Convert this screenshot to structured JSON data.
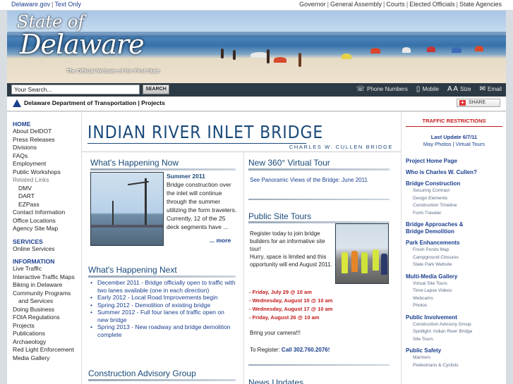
{
  "topbar": {
    "left": [
      "Delaware.gov",
      "Text Only"
    ],
    "right": [
      "Governor",
      "General Assembly",
      "Courts",
      "Elected Officials",
      "State Agencies"
    ]
  },
  "banner": {
    "logo_line1": "State of",
    "logo_line2": "Delaware",
    "tagline": "The Official Website of the First State"
  },
  "search": {
    "placeholder": "Your Search...",
    "button": "SEARCH"
  },
  "tools": {
    "phone": "Phone Numbers",
    "mobile": "Mobile",
    "size": "Size",
    "email": "Email",
    "size_glyph": "A A"
  },
  "agency": {
    "title": "Delaware Department of Transportation | Projects",
    "share": "SHARE"
  },
  "leftnav": {
    "home": "HOME",
    "main_items": [
      "About DelDOT",
      "Press Releases",
      "Divisions",
      "FAQs",
      "Employment",
      "Public Workshops"
    ],
    "related_label": "Related Links",
    "related_items": [
      "DMV",
      "DART",
      "EZPass"
    ],
    "tail_items": [
      "Contact Information",
      "Office Locations",
      "Agency Site Map"
    ],
    "services_hd": "SERVICES",
    "services_items": [
      "Online Services"
    ],
    "info_hd": "INFORMATION",
    "info_items": [
      "Live Traffic",
      "Interactive Traffic Maps",
      "Biking in Delaware",
      "Community Programs",
      "and Services",
      "Doing Business",
      "FOIA Regulations",
      "Projects",
      "Publications",
      "Archaeology",
      "Red Light Enforcement",
      "Media Gallery"
    ]
  },
  "page": {
    "title": "INDIAN RIVER INLET BRIDGE",
    "subtitle": "CHARLES W. CULLEN BRIDGE"
  },
  "happening_now": {
    "heading": "What's Happening Now",
    "season": "Summer 2011",
    "body": "Bridge construction over the inlet will continue through the summer utilizing the form travelers. Currently, 12 of the 25 deck segments have ...",
    "more": "... more"
  },
  "happening_next": {
    "heading": "What's Happening Next",
    "items": [
      "December 2011 - Bridge officially open to traffic with two lanes available (one in each direction)",
      "Early 2012 - Local Road Improvements begin",
      "Spring 2012 - Demolition of existing bridge",
      "Summer 2012 - Full four lanes of traffic open on new bridge",
      "Spring 2013 - New roadway and bridge demolition complete"
    ]
  },
  "construction_group": {
    "heading": "Construction Advisory Group"
  },
  "virtual_tour": {
    "heading": "New 360° Virtual Tour",
    "link": "See Panoramic Views of the Bridge: June 2011"
  },
  "site_tours": {
    "heading": "Public Site Tours",
    "intro": "Register today to join bridge builders for an informative site tour!",
    "note": "Hurry, space is limited and this opportunity will end August 2011.",
    "dates": [
      "- Friday, July 29 @ 10 am",
      "- Wednesday, August 10 @ 10 am",
      "- Wednesday, August 17 @ 10 am",
      "- Friday, August 26 @ 10 am"
    ],
    "camera": "Bring your camera!!!",
    "register_label": "To Register:",
    "register_phone": "Call 302.760.2076!"
  },
  "news": {
    "heading": "News Updates"
  },
  "right": {
    "traffic": "TRAFFIC RESTRICTIONS",
    "last_update": "Last Update 6/7/11",
    "links": "May Photos | Virtual Tours",
    "sections": [
      {
        "hd": "Project Home Page",
        "items": []
      },
      {
        "hd": "Who is Charles W. Cullen?",
        "items": []
      },
      {
        "hd": "Bridge Construction",
        "items": [
          "Securing Contract",
          "Design Elements",
          "Construction Timeline",
          "Form Traveler"
        ]
      },
      {
        "hd": "Bridge Approaches & Bridge Demolition",
        "items": []
      },
      {
        "hd": "Park Enhancements",
        "items": [
          "Fresh Ponds Map",
          "Campground Closures",
          "State Park Website"
        ]
      },
      {
        "hd": "Multi-Media Gallery",
        "items": [
          "Virtual Site Tours",
          "Time-Lapse Videos",
          "Webcams",
          "Photos"
        ]
      },
      {
        "hd": "Public Involvement",
        "items": [
          "Construction Advisory Group",
          "Spotlight: Indian River Bridge",
          "Site Tours"
        ]
      },
      {
        "hd": "Public Safety",
        "items": [
          "Mariners",
          "Pedestrians & Cyclists"
        ]
      }
    ]
  }
}
